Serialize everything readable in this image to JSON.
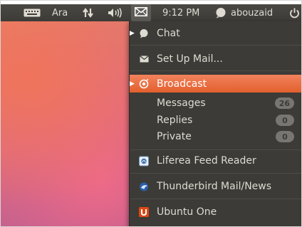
{
  "panel": {
    "keyboard_layout": "Ara",
    "time": "9:12 PM",
    "username": "abouzaid",
    "icons": [
      "keyboard-icon",
      "network-icon",
      "volume-icon",
      "mail-icon",
      "user-status-icon",
      "power-icon"
    ]
  },
  "menu": {
    "items": [
      {
        "label": "Chat",
        "icon": "chat-bubble-icon",
        "has_arrow": true
      },
      {
        "label": "Set Up Mail...",
        "icon": "envelope-icon"
      },
      {
        "label": "Broadcast",
        "icon": "broadcast-icon",
        "has_arrow": true,
        "highlighted": true
      },
      {
        "label": "Messages",
        "count": "26"
      },
      {
        "label": "Replies",
        "count": "0"
      },
      {
        "label": "Private",
        "count": "0"
      },
      {
        "label": "Liferea Feed Reader",
        "icon": "liferea-icon"
      },
      {
        "label": "Thunderbird Mail/News",
        "icon": "thunderbird-icon"
      },
      {
        "label": "Ubuntu One",
        "icon": "ubuntu-one-icon"
      }
    ]
  },
  "colors": {
    "panel_bg": "#3c3b37",
    "highlight": "#ef7046",
    "badge_bg": "#777672",
    "ubuntu_one": "#dd4814"
  }
}
